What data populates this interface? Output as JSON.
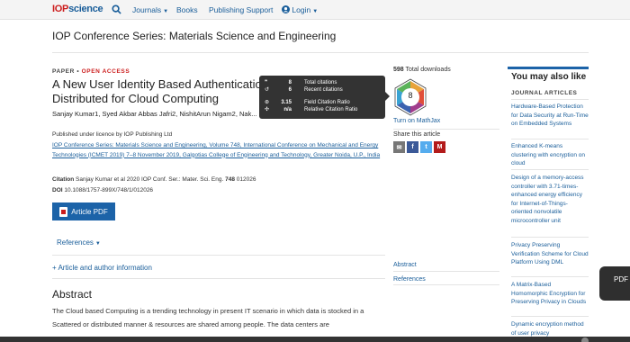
{
  "nav": {
    "logo_prefix": "IOP",
    "logo_suffix": "science",
    "journals": "Journals",
    "books": "Books",
    "publishing_support": "Publishing Support",
    "login": "Login"
  },
  "journal_title": "IOP Conference Series: Materials Science and Engineering",
  "article": {
    "type_prefix": "PAPER",
    "type_sep": " • ",
    "type_oa": "OPEN ACCESS",
    "title": "A New User Identity Based Authentication ... Distributed for Cloud Computing",
    "authors": "Sanjay Kumar1, Syed Akbar Abbas Jafri2, NishitArun Nigam2, Nak... S K Singh2",
    "published_under": "Published under licence by IOP Publishing Ltd",
    "venue": "IOP Conference Series: Materials Science and Engineering, Volume 748, International Conference on Mechanical and Energy Technologies (ICMET 2019) 7–8 November 2019, Galgotias College of Engineering and Technology, Greater Noida, U.P., India",
    "citation_label": "Citation",
    "citation_text": "Sanjay Kumar et al 2020 IOP Conf. Ser.: Mater. Sci. Eng.",
    "citation_vol": "748",
    "citation_num": "012026",
    "doi_label": "DOI",
    "doi": "10.1088/1757-899X/748/1/012026",
    "pdf_button": "Article PDF",
    "references": "References",
    "article_info": "+ Article and author information",
    "abstract_heading": "Abstract",
    "abstract_text": "The Cloud based Computing is a trending technology in present IT scenario in which data is stocked in a Scattered or distributed manner & resources are shared among people. The data centers are"
  },
  "metrics": {
    "total_citations_value": "8",
    "total_citations_label": "Total citations",
    "recent_citations_value": "6",
    "recent_citations_label": "Recent citations",
    "field_ratio_value": "3.15",
    "field_ratio_label": "Field Citation Ratio",
    "relative_ratio_value": "n/a",
    "relative_ratio_label": "Relative Citation Ratio",
    "badge_value": "8"
  },
  "sidebar": {
    "downloads_count": "598",
    "downloads_label": "Total downloads",
    "mathjax": "Turn on MathJax",
    "share": "Share this article",
    "abstract_link": "Abstract",
    "references_link": "References"
  },
  "ymal": {
    "heading": "You may also like",
    "subheading": "JOURNAL ARTICLES",
    "items": [
      "Hardware-Based Protection for Data Security at Run-Time on Embedded Systems",
      "Enhanced K-means clustering with encryption on cloud",
      "Design of a memory-access controller with 3.71-times-enhanced energy efficiency for Internet-of-Things-oriented nonvolatile microcontroller unit",
      "Privacy Preserving Verification Scheme for Cloud Platform Using DML",
      "A Matrix-Based Homomorphic Encryption for Preserving Privacy in Clouds",
      "Dynamic encryption method of user privacy"
    ]
  },
  "float_pdf": "PDF",
  "colors": {
    "brand_blue": "#1c63a8",
    "brand_red": "#cc1d1d",
    "link": "#1a5e9a"
  }
}
